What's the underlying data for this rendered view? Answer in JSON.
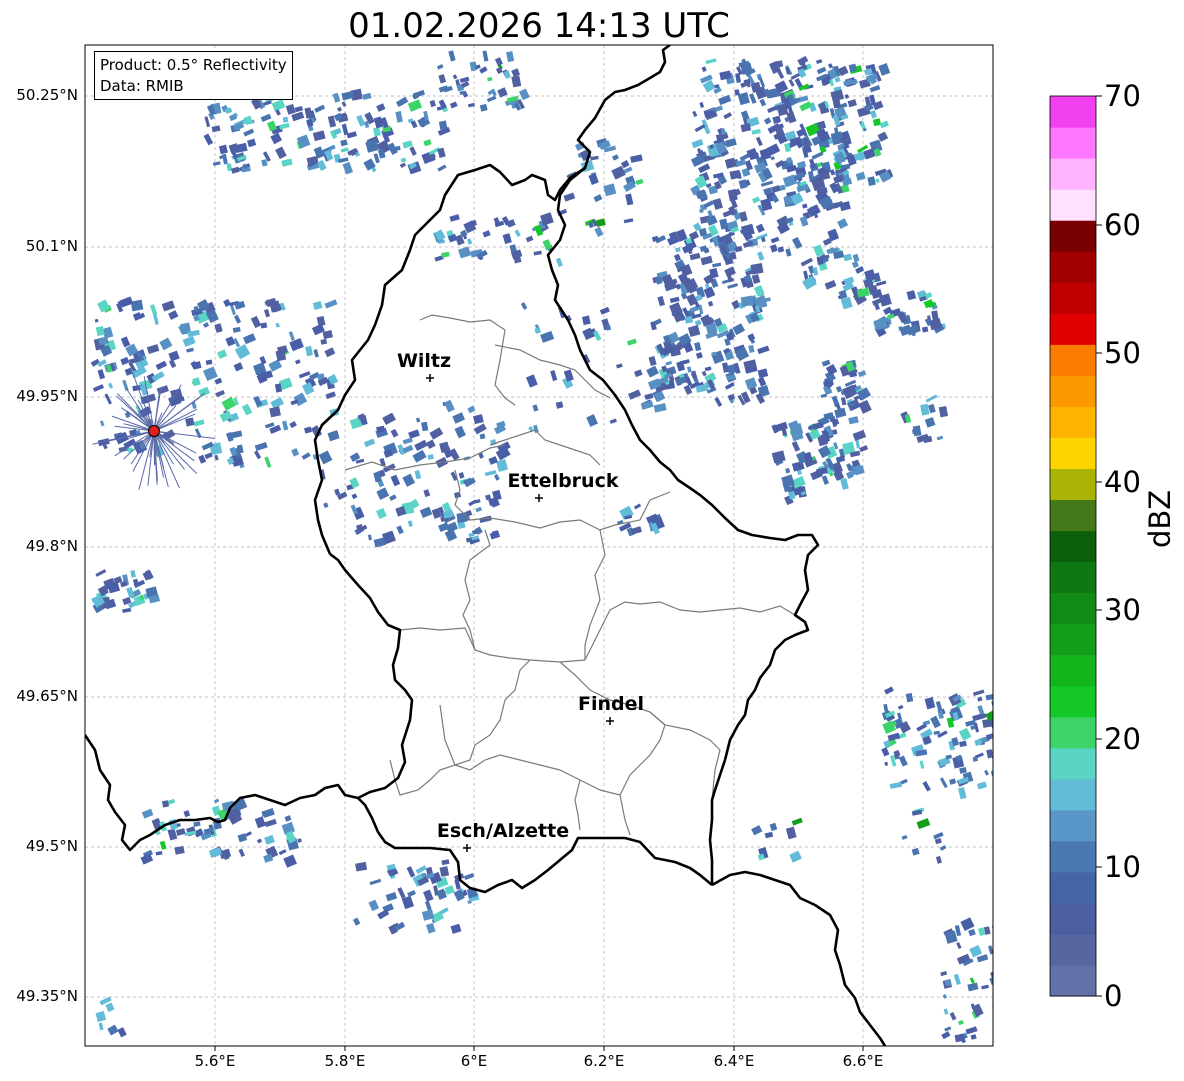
{
  "title": "01.02.2026 14:13 UTC",
  "info": {
    "product": "Product: 0.5° Reflectivity",
    "data_source": "Data: RMIB"
  },
  "axes": {
    "lon_ticks": [
      "5.6°E",
      "5.8°E",
      "6°E",
      "6.2°E",
      "6.4°E",
      "6.6°E"
    ],
    "lat_ticks": [
      "50.25°N",
      "50.1°N",
      "49.95°N",
      "49.8°N",
      "49.65°N",
      "49.5°N",
      "49.35°N"
    ]
  },
  "cities": [
    {
      "name": "Wiltz"
    },
    {
      "name": "Ettelbruck"
    },
    {
      "name": "Findel"
    },
    {
      "name": "Esch/Alzette"
    }
  ],
  "colorbar": {
    "unit": "dBZ",
    "ticks": [
      "70",
      "60",
      "50",
      "40",
      "30",
      "20",
      "10",
      "0"
    ],
    "range": [
      0,
      70
    ],
    "colors": [
      "#6272a8",
      "#56679f",
      "#4b5ea0",
      "#4466a8",
      "#4a78b0",
      "#5897c8",
      "#62bcd8",
      "#5ad4c4",
      "#3cd468",
      "#14c828",
      "#14b41c",
      "#129e18",
      "#128a16",
      "#107812",
      "#0c600c",
      "#447818",
      "#aab404",
      "#fcd400",
      "#fcb400",
      "#fc9800",
      "#fc7c00",
      "#e00000",
      "#c00000",
      "#a00000",
      "#780000",
      "#ffe0ff",
      "#ffb4ff",
      "#ff78ff",
      "#f040f0"
    ]
  },
  "radar_site_color": "#e02020"
}
